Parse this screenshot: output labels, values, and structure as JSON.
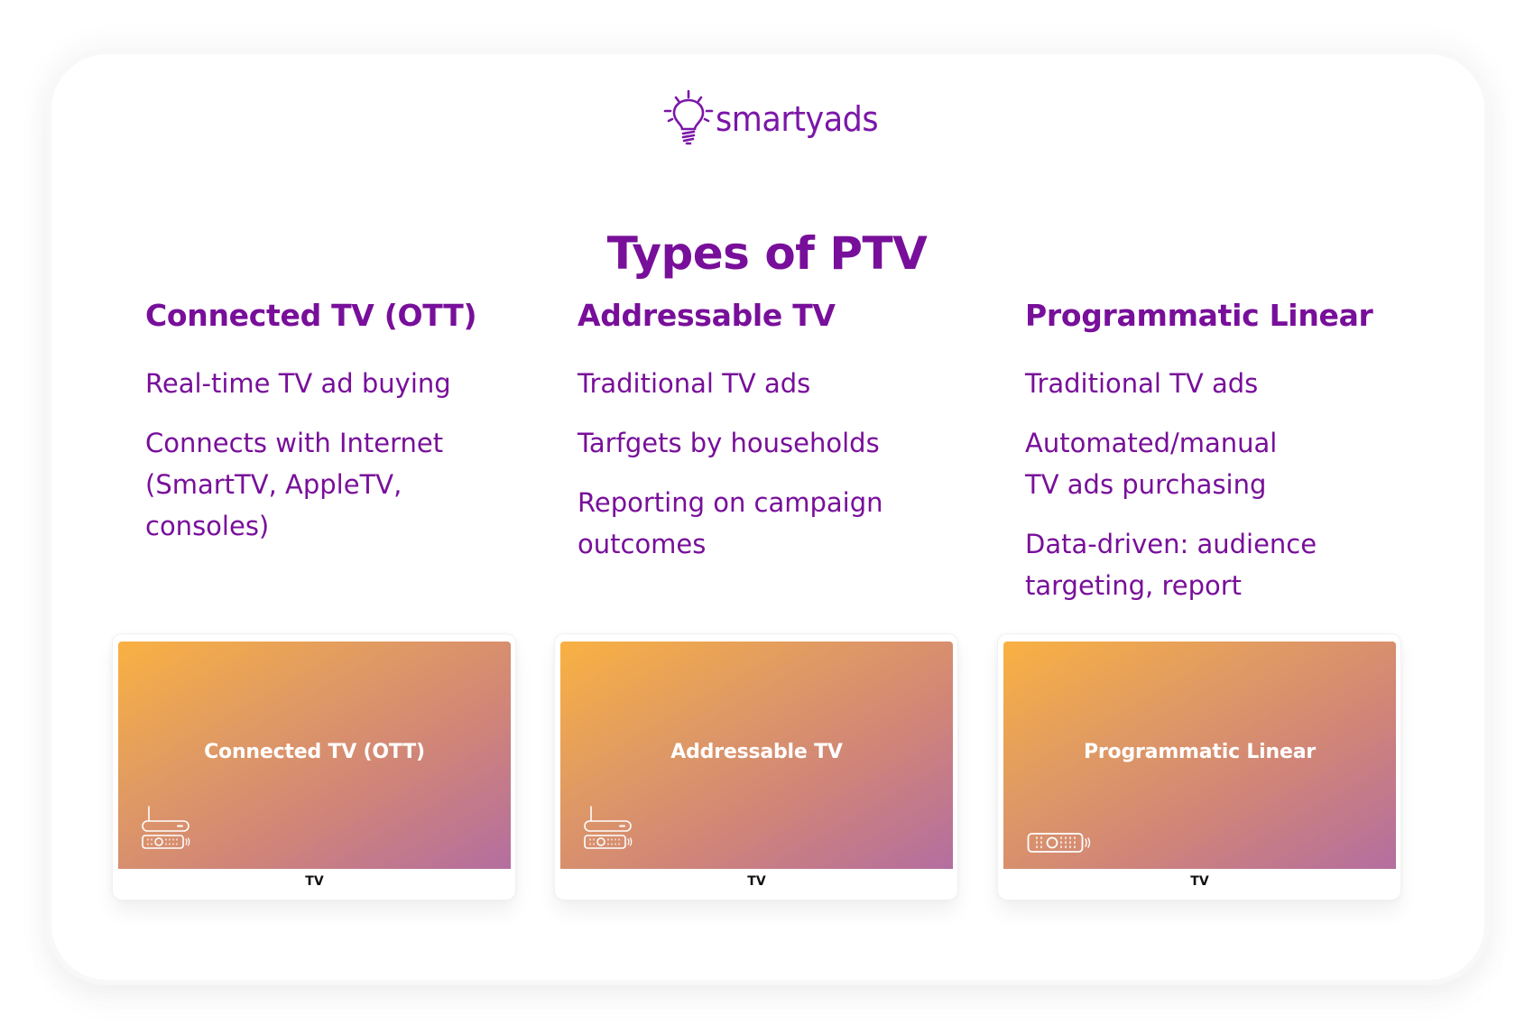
{
  "brand": {
    "name": "smartyads",
    "logo_icon": "lightbulb-icon",
    "color": "#7b16a8"
  },
  "title": "Types of PTV",
  "colors": {
    "text_accent": "#780f9a",
    "gradient_start": "#f9b142",
    "gradient_end": "#b46ea0",
    "tile_label": "#ffffff",
    "footer_text": "#111111"
  },
  "columns": [
    {
      "heading": "Connected TV (OTT)",
      "items": [
        "Real-time TV ad buying",
        "Connects with Internet\n(SmartTV, AppleTV,\nconsoles)"
      ]
    },
    {
      "heading": "Addressable TV",
      "items": [
        "Traditional TV ads",
        "Tarfgets by households",
        "Reporting on campaign\noutcomes"
      ]
    },
    {
      "heading": "Programmatic Linear",
      "items": [
        "Traditional TV ads",
        "Automated/manual\nTV ads purchasing",
        "Data-driven: audience\ntargeting, report"
      ]
    }
  ],
  "tiles": [
    {
      "label": "Connected TV (OTT)",
      "icon": "set-top-box-with-remote-icon",
      "footer": "TV"
    },
    {
      "label": "Addressable TV",
      "icon": "set-top-box-with-remote-icon",
      "footer": "TV"
    },
    {
      "label": "Programmatic Linear",
      "icon": "remote-control-icon",
      "footer": "TV"
    }
  ]
}
